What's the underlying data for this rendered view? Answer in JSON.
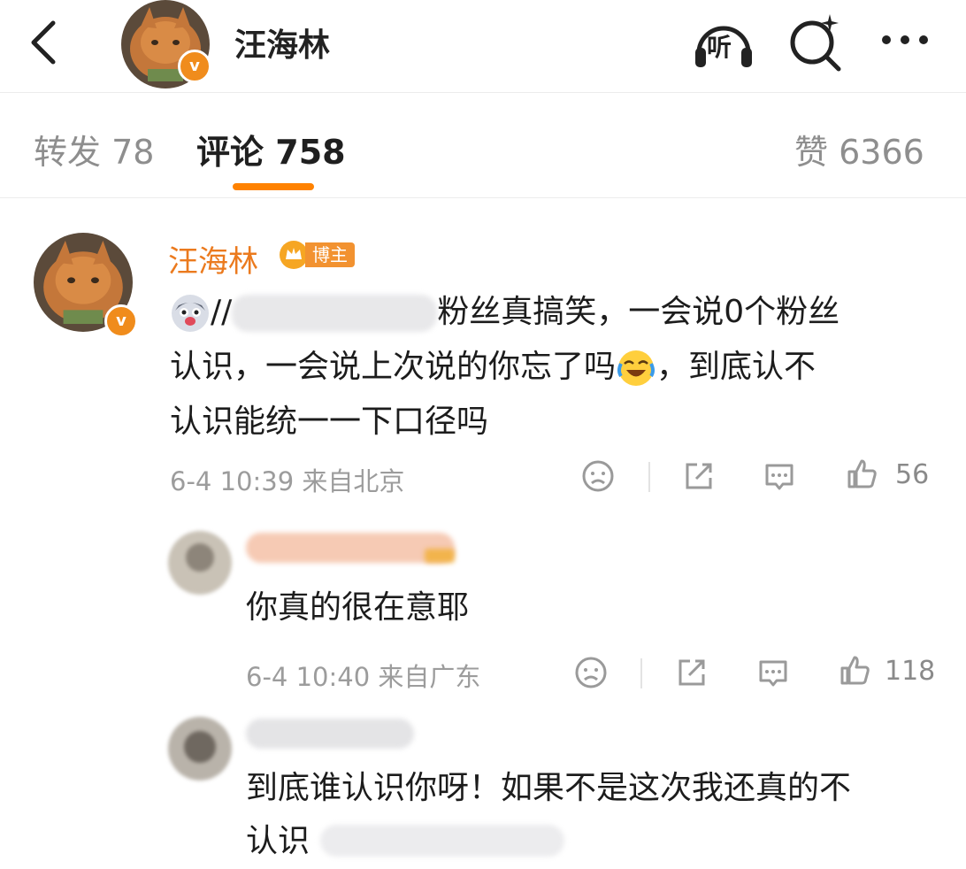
{
  "header": {
    "title": "汪海林",
    "verified_mark": "v",
    "listen_label": "听",
    "back_icon": "chevron-left-icon",
    "search_icon": "search-icon",
    "more_icon": "more-icon"
  },
  "tabs": {
    "repost_label": "转发",
    "repost_count": "78",
    "comment_label": "评论",
    "comment_count": "758",
    "like_label": "赞",
    "like_count": "6366",
    "active": "comment",
    "accent_color": "#ff8200"
  },
  "comment": {
    "author": "汪海林",
    "author_badge": "博主",
    "author_color": "#eb7a1e",
    "lines": [
      {
        "prefix": "//",
        "text": "粉丝真搞笑，一会说0个粉丝"
      },
      {
        "text": "认识，一会说上次说的你忘了吗",
        "after": "，到底认不"
      },
      {
        "text": "认识能统一一下口径吗"
      }
    ],
    "time": "6-4 10:39",
    "location": "来自北京",
    "like_count": "56"
  },
  "replies": [
    {
      "text": "你真的很在意耶",
      "time": "6-4 10:40",
      "location": "来自广东",
      "like_count": "118"
    },
    {
      "lines": [
        "到底谁认识你呀！如果不是这次我还真的不",
        "认识"
      ]
    }
  ]
}
